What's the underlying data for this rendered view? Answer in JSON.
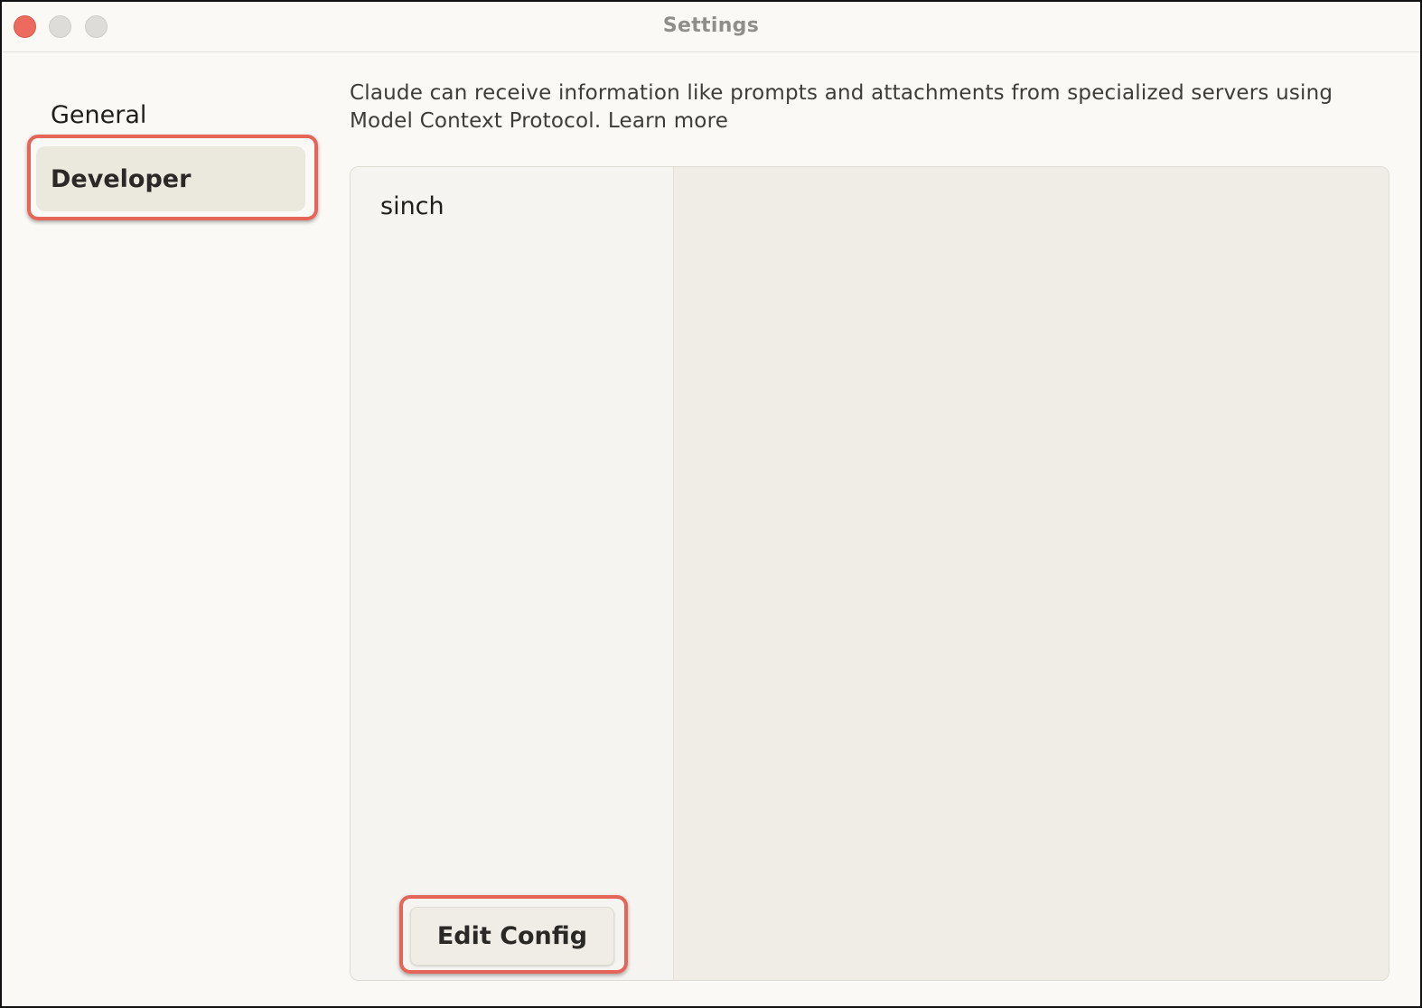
{
  "window": {
    "title": "Settings"
  },
  "sidebar": {
    "items": [
      {
        "label": "General",
        "selected": false
      },
      {
        "label": "Developer",
        "selected": true
      }
    ]
  },
  "developer": {
    "description": "Claude can receive information like prompts and attachments from specialized servers using Model Context Protocol.",
    "learn_more_label": "Learn more",
    "servers": [
      {
        "name": "sinch"
      }
    ],
    "edit_config_label": "Edit Config"
  },
  "colors": {
    "window_bg": "#faf9f5",
    "selected_nav_bg": "#ebe8de",
    "highlight_border": "#e56659",
    "close_button": "#ec6a5e"
  }
}
